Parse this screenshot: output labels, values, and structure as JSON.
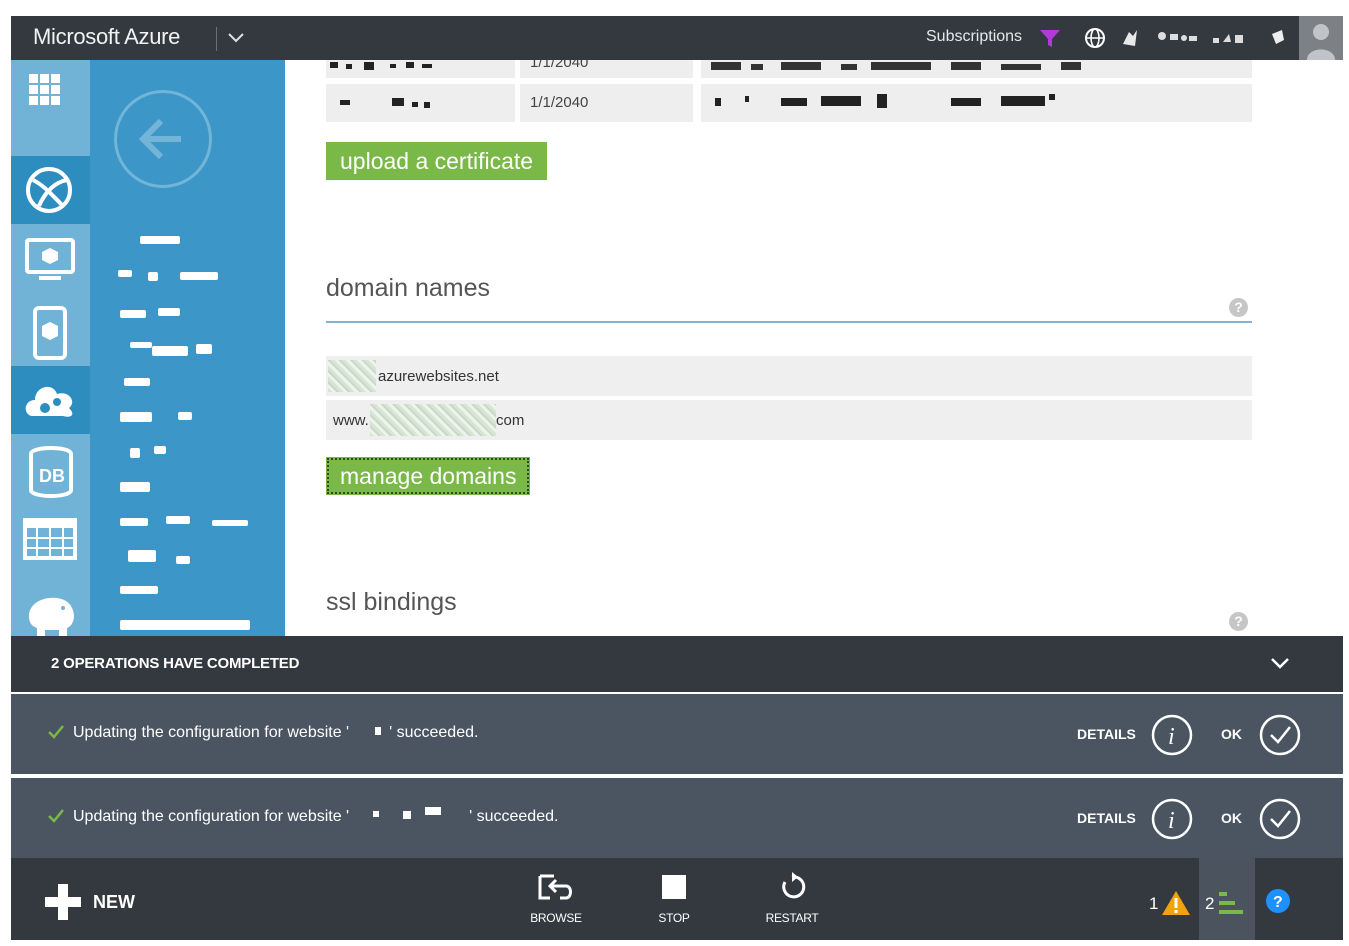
{
  "topbar": {
    "brand": "Microsoft Azure",
    "subscriptions_label": "Subscriptions",
    "colors": {
      "filter": "#b23ad9",
      "bg": "#34393f"
    }
  },
  "rail": {
    "items": [
      {
        "icon": "all-items-grid-icon"
      },
      {
        "icon": "websites-globe-icon",
        "active": true
      },
      {
        "icon": "virtual-machine-icon"
      },
      {
        "icon": "mobile-services-icon"
      },
      {
        "icon": "cloud-services-icon"
      },
      {
        "icon": "sql-database-icon"
      },
      {
        "icon": "storage-table-icon"
      },
      {
        "icon": "hdinsight-elephant-icon"
      }
    ]
  },
  "certificates": {
    "rows": [
      {
        "expires": "1/1/2040"
      },
      {
        "expires": "1/1/2040"
      }
    ],
    "upload_button": "upload a certificate"
  },
  "domains": {
    "title": "domain names",
    "help": "?",
    "rows": [
      {
        "suffix": "azurewebsites.net"
      },
      {
        "prefix": "www.",
        "suffix": "com"
      }
    ],
    "manage_button": "manage domains"
  },
  "ssl": {
    "title": "ssl bindings",
    "help": "?"
  },
  "notifications": {
    "header": "2 OPERATIONS HAVE COMPLETED",
    "items": [
      {
        "text_start": "Updating the configuration for website '",
        "text_end": "' succeeded.",
        "details": "DETAILS",
        "ok": "OK"
      },
      {
        "text_start": "Updating the configuration for website '",
        "text_end": "' succeeded.",
        "details": "DETAILS",
        "ok": "OK"
      }
    ]
  },
  "commandbar": {
    "new": "NEW",
    "browse": "BROWSE",
    "stop": "STOP",
    "restart": "RESTART",
    "warnings_count": "1",
    "progress_count": "2",
    "colors": {
      "warning": "#f0a30a",
      "progress": "#7ab947",
      "help": "#1e90ff"
    }
  }
}
